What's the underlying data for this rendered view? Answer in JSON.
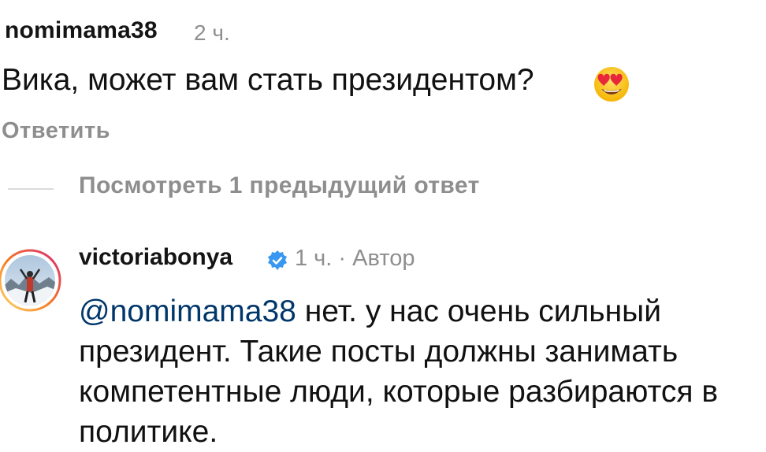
{
  "comment1": {
    "username": "nomimama38",
    "time": "2 ч.",
    "text": "Вика, может вам стать президентом?",
    "emoji": "smiling-face-with-heart-eyes",
    "reply_label": "Ответить"
  },
  "view_previous": {
    "label": "Посмотреть 1 предыдущий ответ"
  },
  "comment2": {
    "username": "victoriabonya",
    "verified": true,
    "time": "1 ч.",
    "separator": "·",
    "author_label": "Автор",
    "mention": "@nomimama38",
    "text": " нет. у нас очень сильный президент.  Такие посты должны занимать компетентные люди, которые разбираются в политике."
  },
  "colors": {
    "text": "#111111",
    "secondary": "#8e8e8e",
    "mention": "#00376b",
    "verified": "#3897f0",
    "story_ring_start": "#feda75",
    "story_ring_end": "#d62976"
  }
}
